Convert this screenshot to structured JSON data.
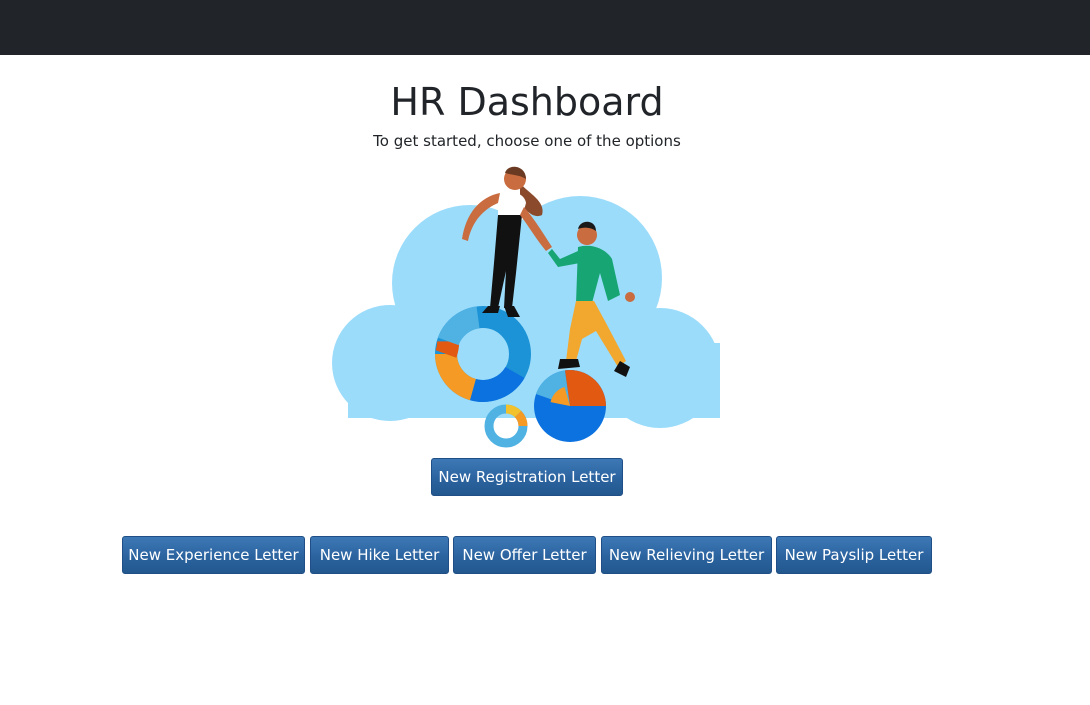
{
  "header": {
    "title": "HR Dashboard",
    "subtitle": "To get started, choose one of the options"
  },
  "illustration": {
    "icon": "team-analytics-illustration",
    "colors": {
      "cloud": "#9bdcfb",
      "blue_dark": "#0b72e0",
      "blue_mid": "#1b93d6",
      "blue_light": "#4fb2e3",
      "orange": "#f49a25",
      "red_orange": "#e25a12",
      "green_jacket": "#17a673",
      "yellow_pants": "#f2a72e",
      "skin": "#c96c3f"
    }
  },
  "actions": {
    "registration": "New Registration Letter",
    "experience": "New Experience Letter",
    "hike": "New Hike Letter",
    "offer": "New Offer Letter",
    "relieving": "New Relieving Letter",
    "payslip": "New Payslip Letter"
  },
  "theme": {
    "topbar": "#212529",
    "button": "#2b639f",
    "text": "#212529"
  }
}
